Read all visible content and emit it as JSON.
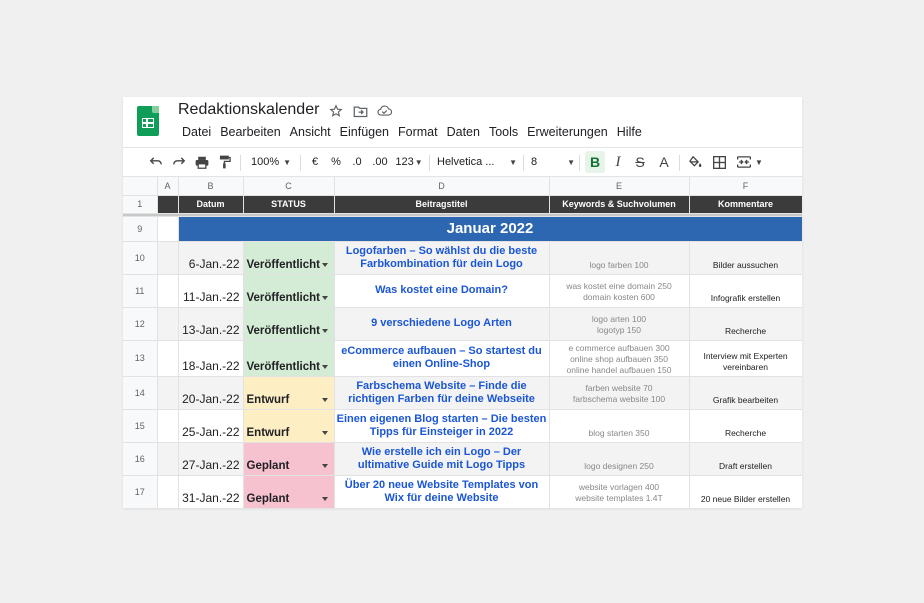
{
  "doc": {
    "title": "Redaktionskalender",
    "icons": [
      "star-icon",
      "move-to-folder-icon",
      "cloud-status-icon"
    ]
  },
  "menu": [
    "Datei",
    "Bearbeiten",
    "Ansicht",
    "Einfügen",
    "Format",
    "Daten",
    "Tools",
    "Erweiterungen",
    "Hilfe"
  ],
  "toolbar": {
    "zoom": "100%",
    "currency": "€",
    "percent": "%",
    "decrease_decimals": ".0",
    "increase_decimals": ".00",
    "number_format": "123",
    "font": "Helvetica ...",
    "font_size": "8",
    "bold": "B",
    "italic": "I",
    "strikethrough": "S",
    "text_color": "A"
  },
  "columns": [
    "A",
    "B",
    "C",
    "D",
    "E",
    "F"
  ],
  "header_row": {
    "num": "1",
    "datum": "Datum",
    "status": "STATUS",
    "beitragstitel": "Beitragstitel",
    "keywords": "Keywords & Suchvolumen",
    "kommentare": "Kommentare"
  },
  "month_row": {
    "num": "9",
    "label": "Januar 2022",
    "color": "#2d67b2"
  },
  "status_colors": {
    "Veröffentlicht": "#d4ecd5",
    "Entwurf": "#fdefc3",
    "Geplant": "#f7c2d0"
  },
  "rows": [
    {
      "num": "10",
      "date": "6-Jan.-22",
      "status": "Veröffentlicht",
      "title": "Logofarben – So wählst du die beste Farbkombination für dein Logo",
      "keywords": "logo farben 100",
      "comment": "Bilder aussuchen"
    },
    {
      "num": "11",
      "date": "11-Jan.-22",
      "status": "Veröffentlicht",
      "title": "Was kostet eine Domain?",
      "keywords": "was kostet eine domain 250\ndomain kosten 600",
      "comment": "Infografik erstellen"
    },
    {
      "num": "12",
      "date": "13-Jan.-22",
      "status": "Veröffentlicht",
      "title": "9 verschiedene Logo Arten",
      "keywords": "logo arten 100\nlogotyp 150",
      "comment": "Recherche"
    },
    {
      "num": "13",
      "date": "18-Jan.-22",
      "status": "Veröffentlicht",
      "title": "eCommerce aufbauen – So startest du einen Online-Shop",
      "keywords": "e commerce aufbauen 300\nonline shop aufbauen 350\nonline handel aufbauen 150",
      "comment": "Interview mit Experten vereinbaren"
    },
    {
      "num": "14",
      "date": "20-Jan.-22",
      "status": "Entwurf",
      "title": "Farbschema Website – Finde die richtigen Farben für deine Webseite",
      "keywords": "farben website 70\nfarbschema website 100",
      "comment": "Grafik bearbeiten"
    },
    {
      "num": "15",
      "date": "25-Jan.-22",
      "status": "Entwurf",
      "title": "Einen eigenen Blog starten – Die besten Tipps für Einsteiger in 2022",
      "keywords": "blog starten 350",
      "comment": "Recherche"
    },
    {
      "num": "16",
      "date": "27-Jan.-22",
      "status": "Geplant",
      "title": "Wie erstelle ich ein Logo – Der ultimative Guide mit Logo Tipps",
      "keywords": "logo designen 250",
      "comment": "Draft erstellen"
    },
    {
      "num": "17",
      "date": "31-Jan.-22",
      "status": "Geplant",
      "title": "Über 20 neue Website Templates von Wix für deine Website",
      "keywords": "website vorlagen 400\nwebsite templates 1.4T",
      "comment": "20 neue Bilder erstellen"
    }
  ]
}
